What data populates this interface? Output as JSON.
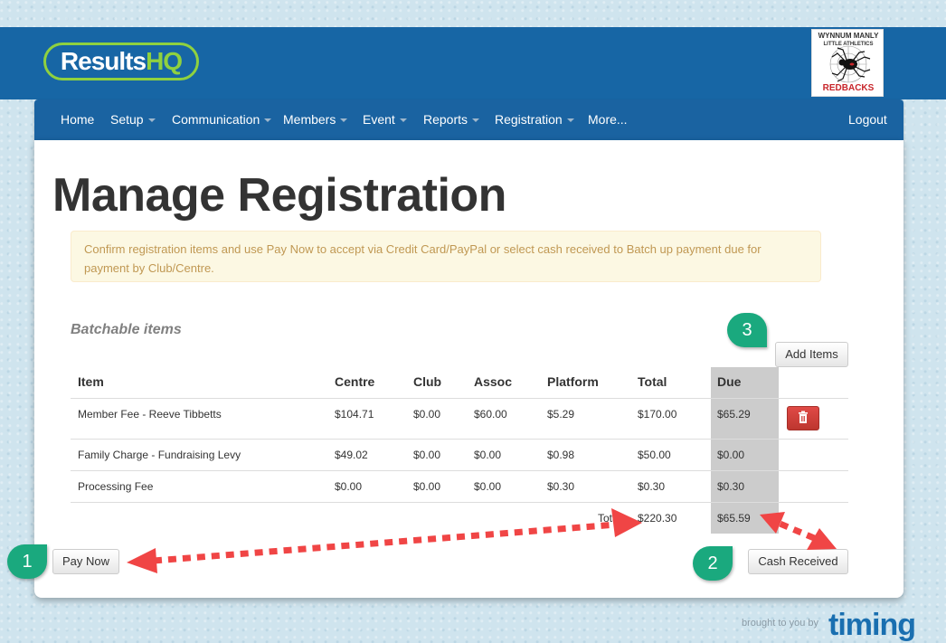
{
  "header": {
    "logo_part1": "Results",
    "logo_part2": "HQ",
    "club_logo_top": "WYNNUM MANLY",
    "club_logo_sub": "LITTLE ATHLETICS",
    "club_logo_bottom": "REDBACKS"
  },
  "nav": {
    "items": [
      {
        "label": "Home"
      },
      {
        "label": "Setup"
      },
      {
        "label": "Communication"
      },
      {
        "label": "Members"
      },
      {
        "label": "Event"
      },
      {
        "label": "Reports"
      },
      {
        "label": "Registration"
      },
      {
        "label": "More..."
      }
    ],
    "logout": "Logout"
  },
  "page": {
    "title": "Manage Registration",
    "alert": "Confirm registration items and use Pay Now to accept via Credit Card/PayPal or select cash received to Batch up payment due for payment by Club/Centre.",
    "section_title": "Batchable items",
    "add_items": "Add Items",
    "pay_now": "Pay Now",
    "cash_received": "Cash Received"
  },
  "table": {
    "headers": [
      "Item",
      "Centre",
      "Club",
      "Assoc",
      "Platform",
      "Total",
      "Due"
    ],
    "rows": [
      [
        "Member Fee - Reeve Tibbetts",
        "$104.71",
        "$0.00",
        "$60.00",
        "$5.29",
        "$170.00",
        "$65.29"
      ],
      [
        "Family Charge - Fundraising Levy",
        "$49.02",
        "$0.00",
        "$0.00",
        "$0.98",
        "$50.00",
        "$0.00"
      ],
      [
        "Processing Fee",
        "$0.00",
        "$0.00",
        "$0.00",
        "$0.30",
        "$0.30",
        "$0.30"
      ]
    ],
    "totals_label": "Totals",
    "total": "$220.30",
    "due_total": "$65.59"
  },
  "callouts": [
    "1",
    "2",
    "3"
  ],
  "footer": {
    "brought": "brought to you by",
    "brand": "timing"
  },
  "colors": {
    "brand_blue": "#1766a5",
    "brand_green": "#8fd13f",
    "callout_green": "#1aa97e",
    "arrow_red": "#f04545",
    "danger_red": "#d9534f"
  }
}
